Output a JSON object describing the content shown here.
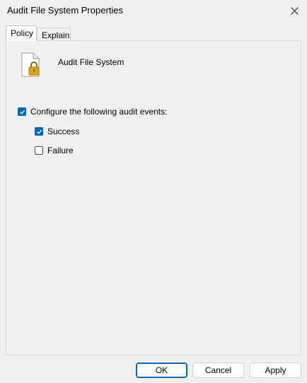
{
  "window": {
    "title": "Audit File System Properties",
    "close_icon": "close-icon"
  },
  "tabs": [
    {
      "label": "Policy",
      "active": true
    },
    {
      "label": "Explain",
      "active": false
    }
  ],
  "policy": {
    "icon": "document-lock-icon",
    "name": "Audit File System"
  },
  "options": {
    "configure": {
      "label": "Configure the following audit events:",
      "checked": true
    },
    "success": {
      "label": "Success",
      "checked": true
    },
    "failure": {
      "label": "Failure",
      "checked": false
    }
  },
  "buttons": {
    "ok": "OK",
    "cancel": "Cancel",
    "apply": "Apply"
  },
  "colors": {
    "accent": "#0067c0",
    "background": "#f0f0f0"
  }
}
